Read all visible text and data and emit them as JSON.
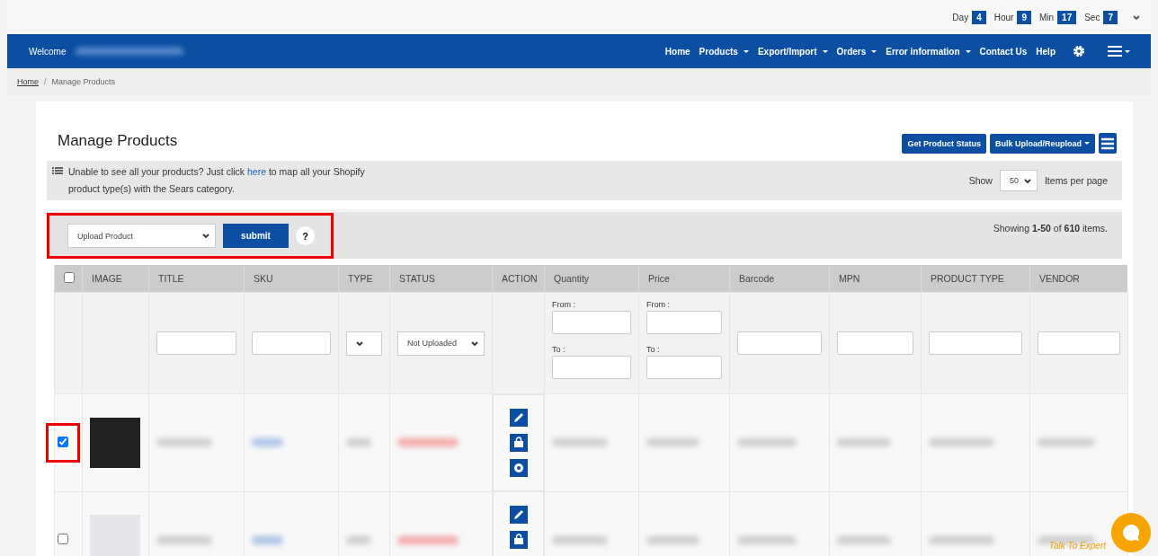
{
  "countdown": [
    {
      "label": "Day",
      "value": "4"
    },
    {
      "label": "Hour",
      "value": "9"
    },
    {
      "label": "Min",
      "value": "17"
    },
    {
      "label": "Sec",
      "value": "7"
    }
  ],
  "navbar": {
    "welcome": "Welcome",
    "items": [
      {
        "label": "Home",
        "dropdown": false
      },
      {
        "label": "Products",
        "dropdown": true
      },
      {
        "label": "Export/Import",
        "dropdown": true
      },
      {
        "label": "Orders",
        "dropdown": true
      },
      {
        "label": "Error information",
        "dropdown": true
      },
      {
        "label": "Contact Us",
        "dropdown": false
      },
      {
        "label": "Help",
        "dropdown": false
      }
    ]
  },
  "breadcrumb": [
    {
      "label": "Home",
      "link": true
    },
    {
      "separator": "/",
      "label": "Manage Products",
      "link": false
    }
  ],
  "page_title": "Manage Products",
  "header_buttons": [
    {
      "label": "Get Product Status",
      "dropdown": false
    },
    {
      "label": "Bulk Upload/Reupload",
      "dropdown": true
    }
  ],
  "notice": {
    "before": "Unable to see all your products? Just click ",
    "link": "here",
    "after": " to map all your Shopify product type(s) with the Sears category."
  },
  "page_size": {
    "show": "Show",
    "value": "50",
    "suffix": "Items per page"
  },
  "bulk_action": {
    "value": "Upload Product",
    "button": "submit",
    "help": "?",
    "highlighted": true
  },
  "summary": "Showing **1-50** of **610** items.",
  "table": {
    "select_all_checked": false,
    "columns": [
      {
        "label": "IMAGE",
        "kind": "none"
      },
      {
        "label": "TITLE",
        "kind": "text"
      },
      {
        "label": "SKU",
        "kind": "text"
      },
      {
        "label": "TYPE",
        "kind": "select"
      },
      {
        "label": "STATUS",
        "kind": "select",
        "value": "Not Uploaded"
      },
      {
        "label": "ACTION",
        "kind": "none"
      },
      {
        "label": "Quantity",
        "kind": "range",
        "from": "From :",
        "to": "To :"
      },
      {
        "label": "Price",
        "kind": "range",
        "from": "From :",
        "to": "To :"
      },
      {
        "label": "Barcode",
        "kind": "text"
      },
      {
        "label": "MPN",
        "kind": "text"
      },
      {
        "label": "PRODUCT TYPE",
        "kind": "text"
      },
      {
        "label": "VENDOR",
        "kind": "text"
      }
    ],
    "rows": [
      {
        "checked": true,
        "highlighted": true
      },
      {
        "checked": false,
        "highlighted": false
      }
    ]
  },
  "chat": {
    "caption": "Talk To Expert"
  }
}
